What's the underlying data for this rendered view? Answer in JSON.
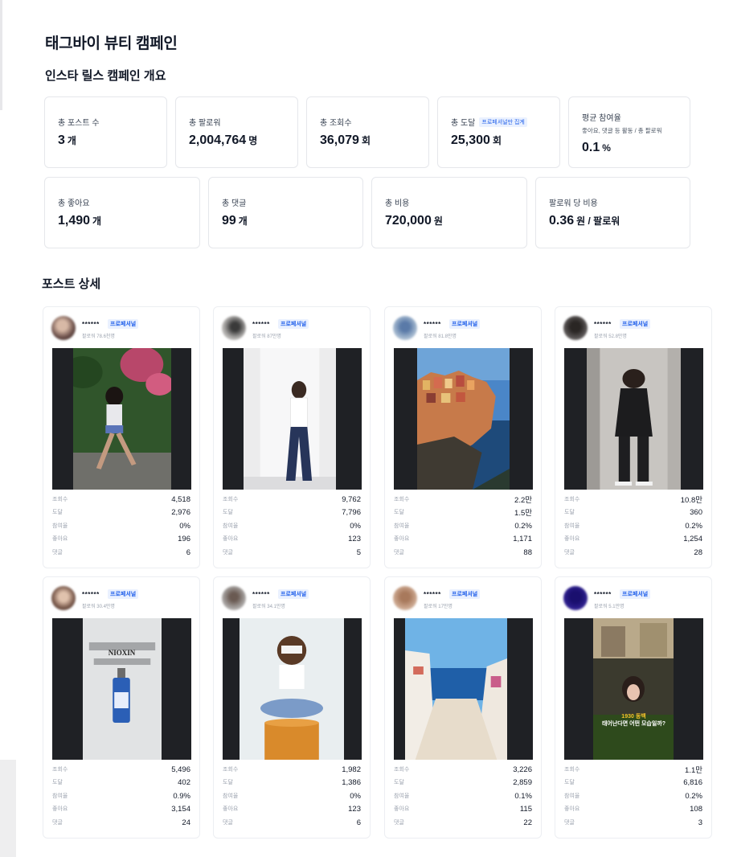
{
  "header": {
    "title": "태그바이 뷰티 캠페인",
    "overview_title": "인스타 릴스 캠페인 개요",
    "posts_title": "포스트 상세"
  },
  "stats": [
    {
      "label": "총 포스트 수",
      "value": "3",
      "unit": "개"
    },
    {
      "label": "총 팔로워",
      "value": "2,004,764",
      "unit": "명"
    },
    {
      "label": "총 조회수",
      "value": "36,079",
      "unit": "회"
    },
    {
      "label": "총 도달",
      "badge": "프로페셔널만 집계",
      "value": "25,300",
      "unit": "회"
    },
    {
      "label": "평균 참여율",
      "sub": "좋아요, 댓글 등 활동 / 총 팔로워",
      "value": "0.1",
      "unit": "%"
    },
    {
      "label": "총 좋아요",
      "value": "1,490",
      "unit": "개"
    },
    {
      "label": "총 댓글",
      "value": "99",
      "unit": "개"
    },
    {
      "label": "총 비용",
      "value": "720,000",
      "unit": "원"
    },
    {
      "label": "팔로워 당 비용",
      "value": "0.36",
      "unit": "원 / 팔로워"
    }
  ],
  "posts": [
    {
      "name": "******",
      "badge": "프로페셔널",
      "followers": "팔로워 78.6천명",
      "avatar_color": "#6b4f4a",
      "metrics": [
        {
          "label": "조회수",
          "value": "4,518"
        },
        {
          "label": "도달",
          "value": "2,976"
        },
        {
          "label": "참여율",
          "value": "0%"
        },
        {
          "label": "좋아요",
          "value": "196"
        },
        {
          "label": "댓글",
          "value": "6"
        }
      ]
    },
    {
      "name": "******",
      "badge": "프로페셔널",
      "followers": "팔로워 87만명",
      "avatar_color": "#8b8a88",
      "metrics": [
        {
          "label": "조회수",
          "value": "9,762"
        },
        {
          "label": "도달",
          "value": "7,796"
        },
        {
          "label": "참여율",
          "value": "0%"
        },
        {
          "label": "좋아요",
          "value": "123"
        },
        {
          "label": "댓글",
          "value": "5"
        }
      ]
    },
    {
      "name": "******",
      "badge": "프로페셔널",
      "followers": "팔로워 81.8만명",
      "avatar_color": "#9fb4cc",
      "metrics": [
        {
          "label": "조회수",
          "value": "2.2만"
        },
        {
          "label": "도달",
          "value": "1.5만"
        },
        {
          "label": "참여율",
          "value": "0.2%"
        },
        {
          "label": "좋아요",
          "value": "1,171"
        },
        {
          "label": "댓글",
          "value": "88"
        }
      ]
    },
    {
      "name": "******",
      "badge": "프로페셔널",
      "followers": "팔로워 52.8만명",
      "avatar_color": "#565252",
      "metrics": [
        {
          "label": "조회수",
          "value": "10.8만"
        },
        {
          "label": "도달",
          "value": "360"
        },
        {
          "label": "참여율",
          "value": "0.2%"
        },
        {
          "label": "좋아요",
          "value": "1,254"
        },
        {
          "label": "댓글",
          "value": "28"
        }
      ]
    },
    {
      "name": "******",
      "badge": "프로페셔널",
      "followers": "팔로워 30.4만명",
      "avatar_color": "#7a5a4c",
      "metrics": [
        {
          "label": "조회수",
          "value": "5,496"
        },
        {
          "label": "도달",
          "value": "402"
        },
        {
          "label": "참여율",
          "value": "0.9%"
        },
        {
          "label": "좋아요",
          "value": "3,154"
        },
        {
          "label": "댓글",
          "value": "24"
        }
      ]
    },
    {
      "name": "******",
      "badge": "프로페셔널",
      "followers": "팔로워 34.1만명",
      "avatar_color": "#a4a09e",
      "metrics": [
        {
          "label": "조회수",
          "value": "1,982"
        },
        {
          "label": "도달",
          "value": "1,386"
        },
        {
          "label": "참여율",
          "value": "0%"
        },
        {
          "label": "좋아요",
          "value": "123"
        },
        {
          "label": "댓글",
          "value": "6"
        }
      ]
    },
    {
      "name": "******",
      "badge": "프로페셔널",
      "followers": "팔로워 17만명",
      "avatar_color": "#c9a48c",
      "metrics": [
        {
          "label": "조회수",
          "value": "3,226"
        },
        {
          "label": "도달",
          "value": "2,859"
        },
        {
          "label": "참여율",
          "value": "0.1%"
        },
        {
          "label": "좋아요",
          "value": "115"
        },
        {
          "label": "댓글",
          "value": "22"
        }
      ]
    },
    {
      "name": "******",
      "badge": "프로페셔널",
      "followers": "팔로워 5.1만명",
      "avatar_color": "#2b1d8a",
      "metrics": [
        {
          "label": "조회수",
          "value": "1.1만"
        },
        {
          "label": "도달",
          "value": "6,816"
        },
        {
          "label": "참여율",
          "value": "0.2%"
        },
        {
          "label": "좋아요",
          "value": "108"
        },
        {
          "label": "댓글",
          "value": "3"
        }
      ]
    }
  ],
  "media_text": {
    "nioxin": "NIOXIN",
    "caption_line1": "1930 동백",
    "caption_line2": "태어난다면 어떤 모습일까?"
  },
  "icons": [
    "profile-avatar-icon"
  ],
  "colors": {
    "accent": "#2563eb",
    "badge_bg": "#eaf1ff",
    "border": "#e5e7eb",
    "media_bg": "#1f2125"
  }
}
